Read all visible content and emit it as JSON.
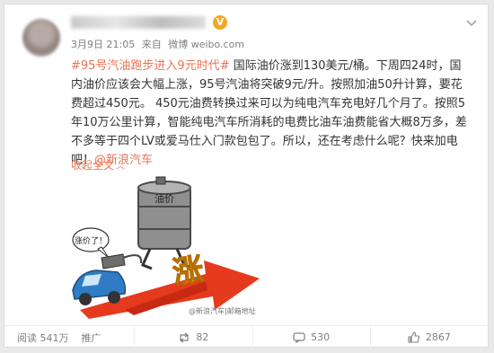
{
  "header": {
    "verified_badge": "V",
    "more_icon": "chevron-down-icon",
    "date": "3月9日 21:05",
    "source_prefix": "来自",
    "source": "微博 weibo.com"
  },
  "post": {
    "hashtag": "#95号汽油跑步进入9元时代#",
    "text": " 国际油价涨到130美元/桶。下周四24时，国内油价应该会大幅上涨，95号汽油将突破9元/升。按照加油50升计算，要花费超过450元。 450元油费转换过来可以为纯电汽车充电好几个月了。按照5年10万公里计算，智能纯电汽车所消耗的电费比油车油费能省大概8万多，差不多等于四个LV或爱马仕入门款包包了。所以，还在考虑什么呢？快来加电吧！",
    "mention": "@新浪汽车",
    "collapse_label": "收起全文"
  },
  "image": {
    "barrel_label": "油价",
    "speech_label": "涨价了！",
    "big_char": "涨",
    "watermark": "@新浪汽车|邮箱地址"
  },
  "footer": {
    "views_label": "阅读 541万",
    "promote_label": "推广",
    "repost_count": "82",
    "comment_count": "530",
    "like_count": "2867"
  },
  "colors": {
    "accent": "#eb7350",
    "verified": "#f5a623",
    "arrow": "#e53a1e",
    "car": "#2f7cc4"
  }
}
